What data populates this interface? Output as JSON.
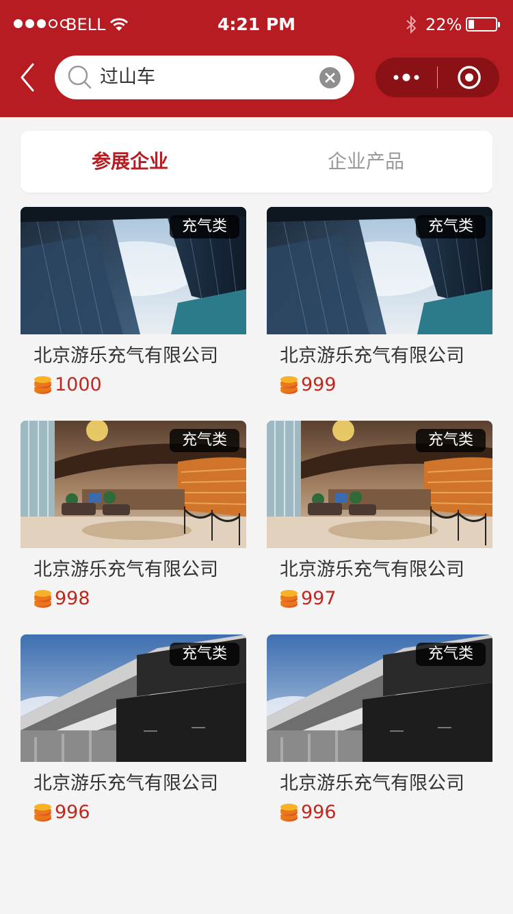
{
  "status_bar": {
    "carrier": "BELL",
    "time": "4:21 PM",
    "battery_percent": "22%",
    "battery_level": 0.22,
    "signal_bars": 3
  },
  "nav": {
    "search_value": "过山车"
  },
  "tabs": [
    {
      "label": "参展企业",
      "active": true
    },
    {
      "label": "企业产品",
      "active": false
    }
  ],
  "cards": [
    {
      "name": "北京游乐充气有限公司",
      "badge": "充气类",
      "price": "1000",
      "image": "skyscraper"
    },
    {
      "name": "北京游乐充气有限公司",
      "badge": "充气类",
      "price": "999",
      "image": "skyscraper"
    },
    {
      "name": "北京游乐充气有限公司",
      "badge": "充气类",
      "price": "998",
      "image": "hotel-lobby"
    },
    {
      "name": "北京游乐充气有限公司",
      "badge": "充气类",
      "price": "997",
      "image": "hotel-lobby"
    },
    {
      "name": "北京游乐充气有限公司",
      "badge": "充气类",
      "price": "996",
      "image": "office-building"
    },
    {
      "name": "北京游乐充气有限公司",
      "badge": "充气类",
      "price": "996",
      "image": "office-building"
    }
  ],
  "colors": {
    "brand_red": "#b71c22",
    "price_red": "#c0281f",
    "capsule": "#8a1217"
  }
}
